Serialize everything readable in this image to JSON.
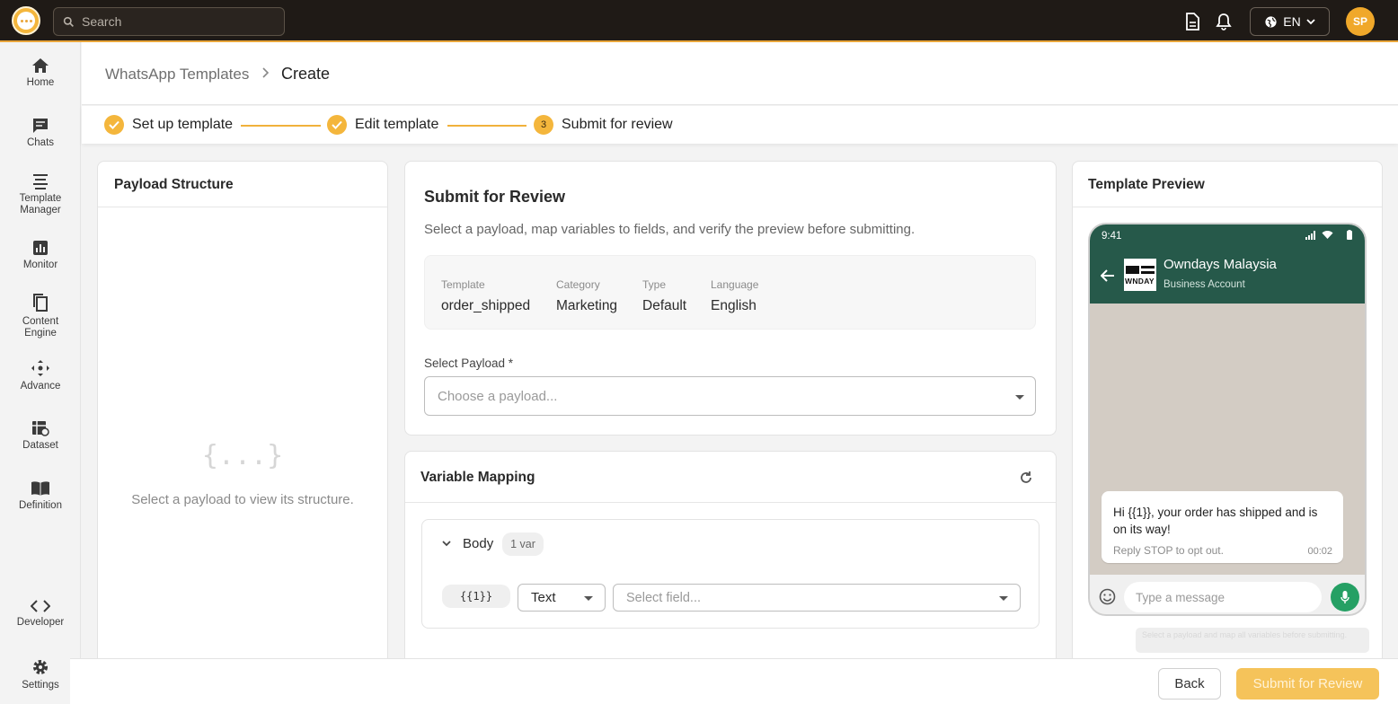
{
  "topbar": {
    "search_placeholder": "Search",
    "language": "EN",
    "avatar_initials": "SP"
  },
  "sidebar": {
    "items": [
      {
        "label": "Home",
        "icon": "home-icon"
      },
      {
        "label": "Chats",
        "icon": "chat-icon"
      },
      {
        "label": "Template Manager",
        "icon": "template-icon"
      },
      {
        "label": "Monitor",
        "icon": "monitor-icon"
      },
      {
        "label": "Content Engine",
        "icon": "copy-icon"
      },
      {
        "label": "Advance",
        "icon": "move-icon"
      },
      {
        "label": "Dataset",
        "icon": "dataset-icon"
      },
      {
        "label": "Definition",
        "icon": "book-icon"
      },
      {
        "label": "Developer",
        "icon": "code-icon"
      },
      {
        "label": "Settings",
        "icon": "gear-icon"
      }
    ]
  },
  "breadcrumb": {
    "parent": "WhatsApp Templates",
    "current": "Create"
  },
  "stepper": {
    "steps": [
      {
        "label": "Set up template",
        "state": "done"
      },
      {
        "label": "Edit template",
        "state": "done"
      },
      {
        "label": "Submit for review",
        "state": "active",
        "number": "3"
      }
    ]
  },
  "payload_panel": {
    "title": "Payload Structure",
    "empty_icon": "{...}",
    "empty_text": "Select a payload to view its structure."
  },
  "review": {
    "title": "Submit for Review",
    "subtitle": "Select a payload, map variables to fields, and verify the preview before submitting.",
    "meta": {
      "template_label": "Template",
      "template_value": "order_shipped",
      "category_label": "Category",
      "category_value": "Marketing",
      "type_label": "Type",
      "type_value": "Default",
      "language_label": "Language",
      "language_value": "English"
    },
    "payload_label": "Select Payload *",
    "payload_placeholder": "Choose a payload..."
  },
  "variable_mapping": {
    "title": "Variable Mapping",
    "section": "Body",
    "section_count": "1 var",
    "variable": "{{1}}",
    "type_value": "Text",
    "field_placeholder": "Select field..."
  },
  "preview": {
    "title": "Template Preview",
    "time": "9:41",
    "business_name": "Owndays Malaysia",
    "business_sub": "Business Account",
    "logo_text": "WNDAY",
    "message": "Hi {{1}}, your order has shipped and is on its way!",
    "footer": "Reply STOP to opt out.",
    "msg_time": "00:02",
    "input_placeholder": "Type a message",
    "tooltip": "Select a payload and map all variables before submitting."
  },
  "actions": {
    "back": "Back",
    "submit": "Submit for Review"
  },
  "colors": {
    "accent": "#f4b63c",
    "topbar": "#1f1a16",
    "wa_green": "#26594a"
  }
}
